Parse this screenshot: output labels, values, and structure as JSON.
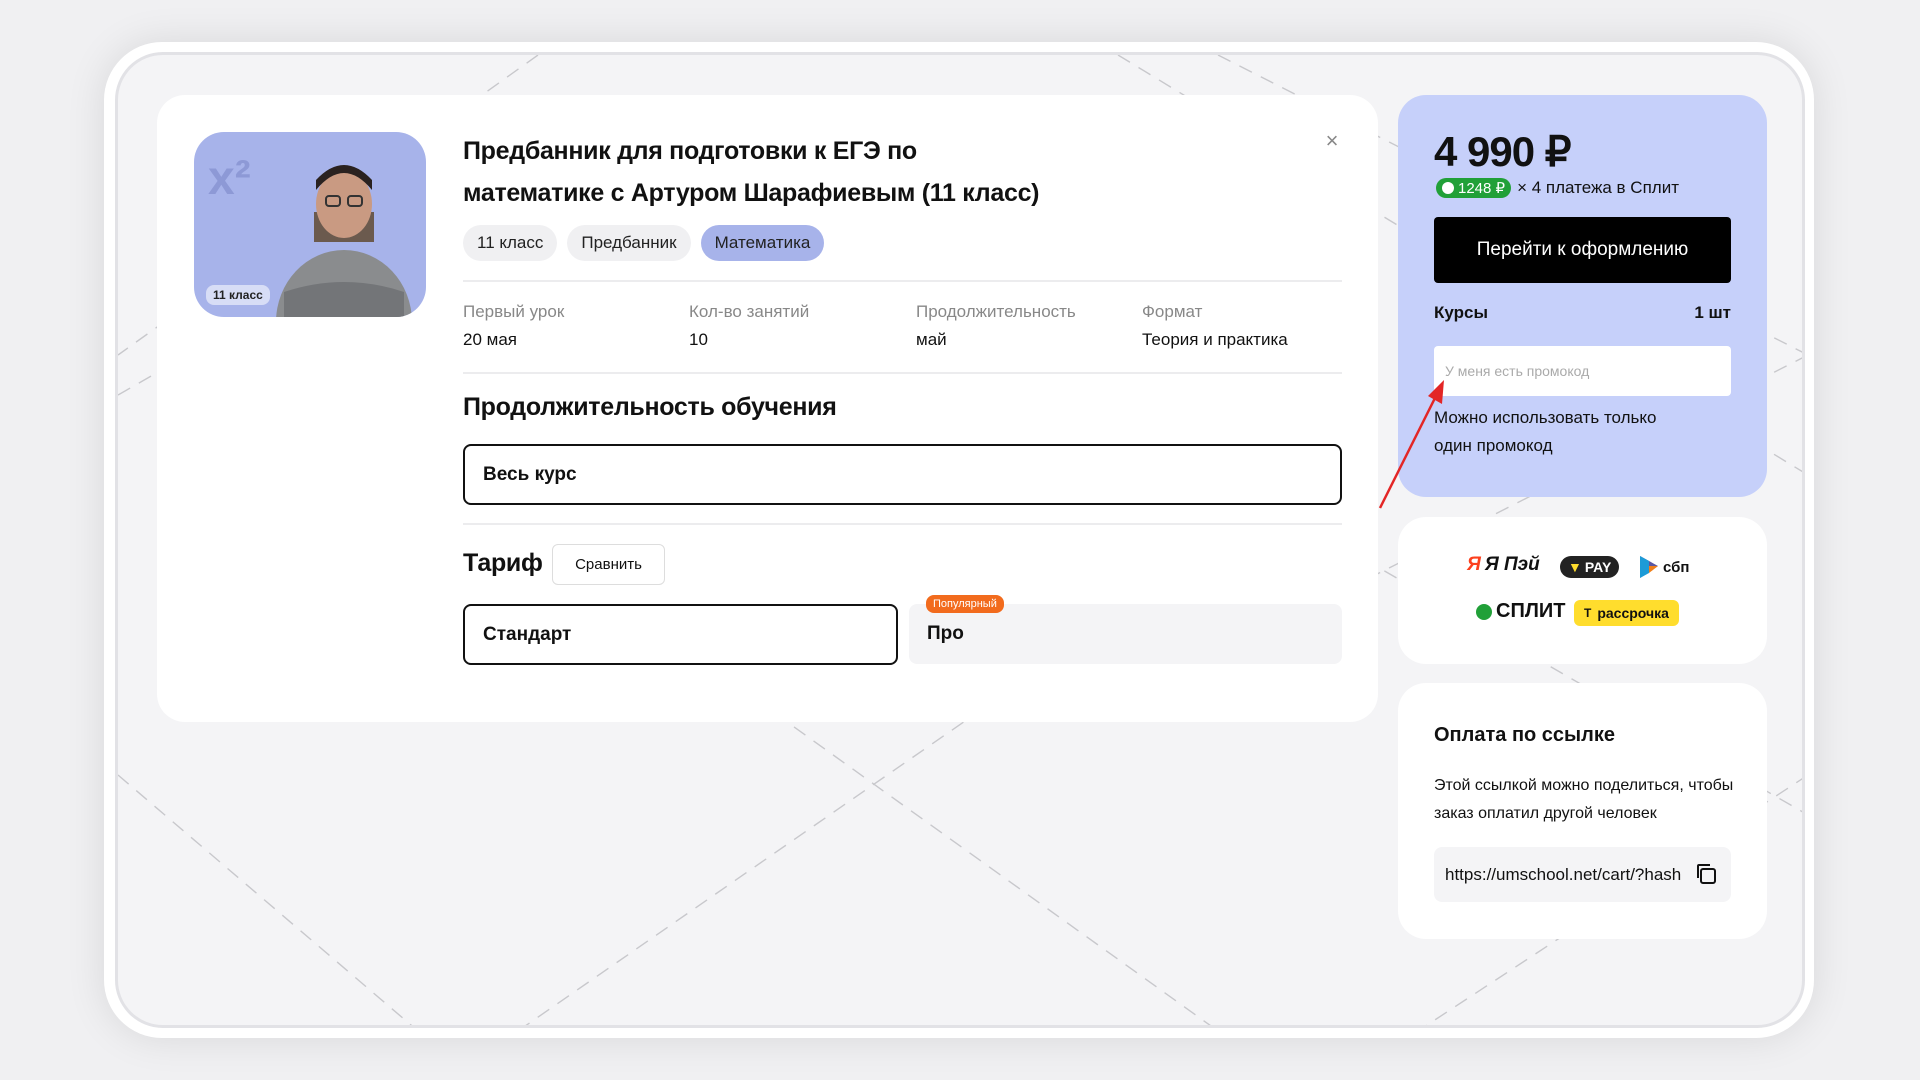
{
  "thumbnail": {
    "badge": "11 класс"
  },
  "course": {
    "title": "Предбанник для подготовки к ЕГЭ по математике с Артуром Шарафиевым (11 класс)",
    "tags": [
      "11 класс",
      "Предбанник",
      "Математика"
    ],
    "info": [
      {
        "label": "Первый урок",
        "value": "20 мая"
      },
      {
        "label": "Кол-во занятий",
        "value": "10"
      },
      {
        "label": "Продолжительность",
        "value": "май"
      },
      {
        "label": "Формат",
        "value": "Теория и практика"
      }
    ]
  },
  "duration": {
    "heading": "Продолжительность обучения",
    "selected": "Весь курс"
  },
  "tariff": {
    "heading": "Тариф",
    "compare_label": "Сравнить",
    "plans": [
      {
        "name": "Стандарт",
        "selected": true
      },
      {
        "name": "Про",
        "badge": "Популярный"
      }
    ]
  },
  "summary": {
    "price": "4 990 ₽",
    "split_amount": "1248 ₽",
    "split_text": "× 4 платежа в Сплит",
    "checkout_label": "Перейти к оформлению",
    "courses_label": "Курсы",
    "courses_qty": "1 шт",
    "promo_placeholder": "У меня есть промокод",
    "promo_note": "Можно использовать только один промокод"
  },
  "payments": {
    "logos": [
      "Я Пэй",
      "PAY",
      "сбп",
      "СПЛИТ",
      "рассрочка"
    ]
  },
  "link_payment": {
    "title": "Оплата по ссылке",
    "description": "Этой ссылкой можно поделиться, чтобы заказ оплатил другой человек",
    "url": "https://umschool.net/cart/?hash"
  },
  "colors": {
    "accent": "#a7b3ea",
    "summary_bg": "#c6d0fa",
    "popular": "#f26b1d",
    "split_green": "#21a038"
  }
}
